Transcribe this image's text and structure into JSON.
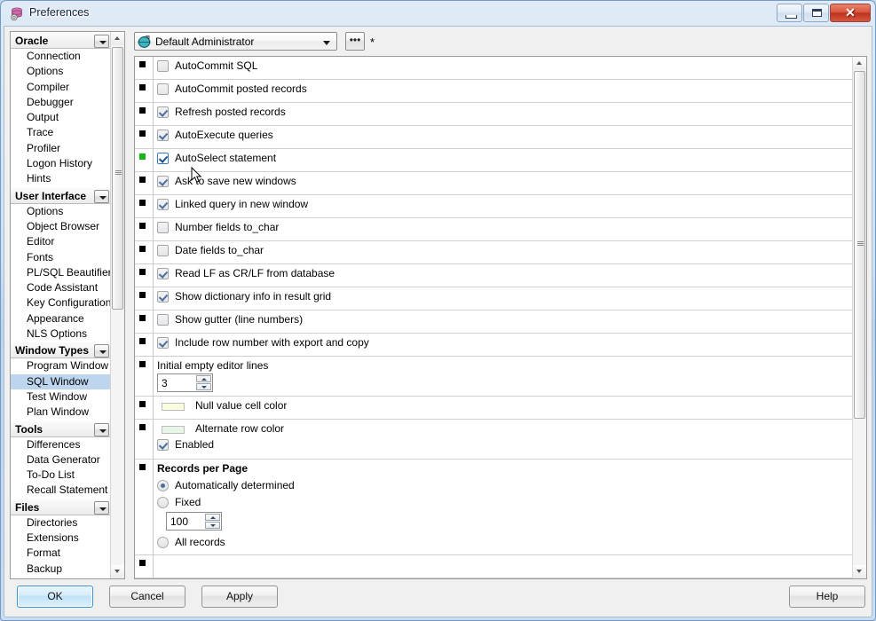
{
  "window": {
    "title": "Preferences",
    "icon": "database-preferences-icon",
    "buttons": {
      "minimize": "minimize-icon",
      "maximize": "maximize-icon",
      "close": "✕"
    }
  },
  "toolbar": {
    "profile_value": "Default Administrator",
    "profile_icon": "profile-globe-icon",
    "browse_label": "•••",
    "modified_marker": "*"
  },
  "sidebar": {
    "groups": [
      {
        "label": "Oracle",
        "items": [
          "Connection",
          "Options",
          "Compiler",
          "Debugger",
          "Output",
          "Trace",
          "Profiler",
          "Logon History",
          "Hints"
        ]
      },
      {
        "label": "User Interface",
        "items": [
          "Options",
          "Object Browser",
          "Editor",
          "Fonts",
          "PL/SQL Beautifier",
          "Code Assistant",
          "Key Configuration",
          "Appearance",
          "NLS Options"
        ]
      },
      {
        "label": "Window Types",
        "items": [
          "Program Window",
          "SQL Window",
          "Test Window",
          "Plan Window"
        ],
        "selected": "SQL Window"
      },
      {
        "label": "Tools",
        "items": [
          "Differences",
          "Data Generator",
          "To-Do List",
          "Recall Statement"
        ]
      },
      {
        "label": "Files",
        "items": [
          "Directories",
          "Extensions",
          "Format",
          "Backup"
        ]
      }
    ]
  },
  "options": {
    "checkboxes": [
      {
        "label": "AutoCommit SQL",
        "checked": false,
        "marker": "black",
        "focused": false
      },
      {
        "label": "AutoCommit posted records",
        "checked": false,
        "marker": "black",
        "focused": false
      },
      {
        "label": "Refresh posted records",
        "checked": true,
        "marker": "black",
        "focused": false
      },
      {
        "label": "AutoExecute queries",
        "checked": true,
        "marker": "black",
        "focused": false
      },
      {
        "label": "AutoSelect statement",
        "checked": true,
        "marker": "green",
        "focused": true
      },
      {
        "label": "Ask to save new windows",
        "checked": true,
        "marker": "black",
        "focused": false
      },
      {
        "label": "Linked query in new window",
        "checked": true,
        "marker": "black",
        "focused": false
      },
      {
        "label": "Number fields to_char",
        "checked": false,
        "marker": "black",
        "focused": false
      },
      {
        "label": "Date fields to_char",
        "checked": false,
        "marker": "black",
        "focused": false
      },
      {
        "label": "Read LF as CR/LF from database",
        "checked": true,
        "marker": "black",
        "focused": false
      },
      {
        "label": "Show dictionary info in result grid",
        "checked": true,
        "marker": "black",
        "focused": false
      },
      {
        "label": "Show gutter (line numbers)",
        "checked": false,
        "marker": "black",
        "focused": false
      },
      {
        "label": "Include row number with export and copy",
        "checked": true,
        "marker": "black",
        "focused": false
      }
    ],
    "editor_lines": {
      "label": "Initial empty editor lines",
      "value": "3"
    },
    "null_color": {
      "label": "Null value cell color",
      "color": "#FBFBE0"
    },
    "alternate_color": {
      "label": "Alternate row color",
      "color": "#E6F5E6",
      "enabled_label": "Enabled",
      "enabled": true
    },
    "records_per_page": {
      "title": "Records per Page",
      "options": [
        {
          "label": "Automatically determined",
          "selected": true
        },
        {
          "label": "Fixed",
          "selected": false
        },
        {
          "label": "All records",
          "selected": false
        }
      ],
      "fixed_value": "100"
    }
  },
  "footer": {
    "ok": "OK",
    "cancel": "Cancel",
    "apply": "Apply",
    "help": "Help"
  },
  "colors": {
    "selection": "#BED6ED",
    "modified_marker": "#17B517",
    "close_button": "#BC2F1C"
  }
}
